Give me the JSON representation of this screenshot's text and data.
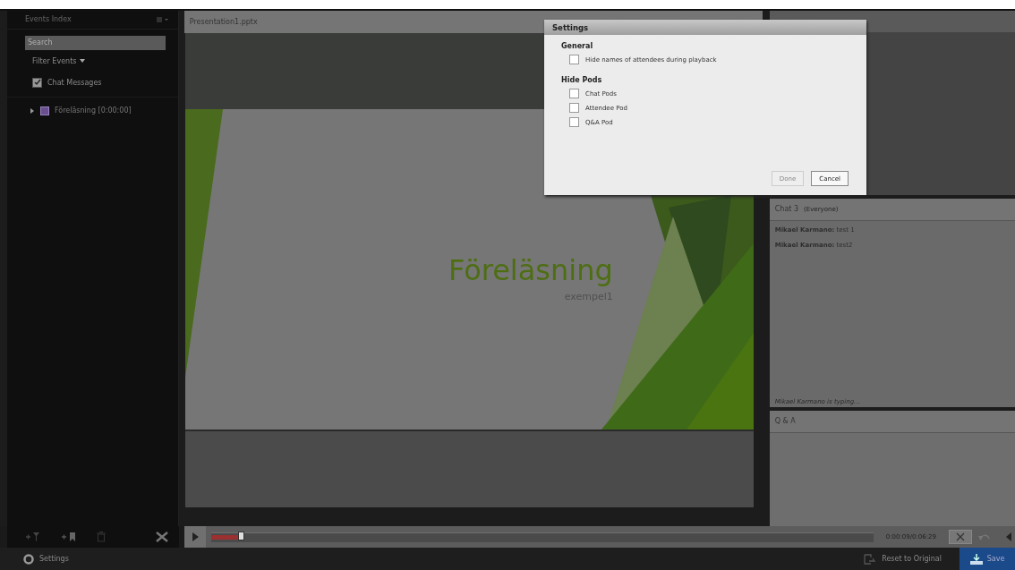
{
  "events_panel": {
    "title": "Events Index",
    "search": {
      "placeholder": "Search"
    },
    "filter": "Filter Events",
    "filters": [
      {
        "label": "Chat Messages",
        "checked": true
      }
    ],
    "tree": [
      {
        "label": "Föreläsning [0:00:00]",
        "expanded": false
      }
    ]
  },
  "presentation": {
    "title": "Presentation1.pptx",
    "slide_title": "Föreläsning",
    "slide_subtitle": "exempel1"
  },
  "chat": {
    "title": "Chat 3",
    "audience": "(Everyone)",
    "messages": [
      {
        "sender": "Mikael Karmano:",
        "text": "test 1"
      },
      {
        "sender": "Mikael Karmano:",
        "text": "test2"
      }
    ],
    "typing": "Mikael Karmano is typing..."
  },
  "qa": {
    "title": "Q & A"
  },
  "timeline": {
    "level": 0.045,
    "time": "0:00:09/0:06:29"
  },
  "dialog": {
    "title": "Settings",
    "sections": [
      {
        "heading": "General",
        "options": [
          {
            "label": "Hide names of attendees during playback",
            "checked": false
          }
        ]
      },
      {
        "heading": "Hide Pods",
        "options": [
          {
            "label": "Chat Pods",
            "checked": false
          },
          {
            "label": "Attendee Pod",
            "checked": false
          },
          {
            "label": "Q&A Pod",
            "checked": false
          }
        ]
      }
    ],
    "buttons": [
      {
        "label": "Done",
        "disabled": true
      },
      {
        "label": "Cancel",
        "disabled": false
      }
    ]
  },
  "status_bar": {
    "settings": "Settings",
    "reset": "Reset to Original",
    "save": "Save"
  }
}
